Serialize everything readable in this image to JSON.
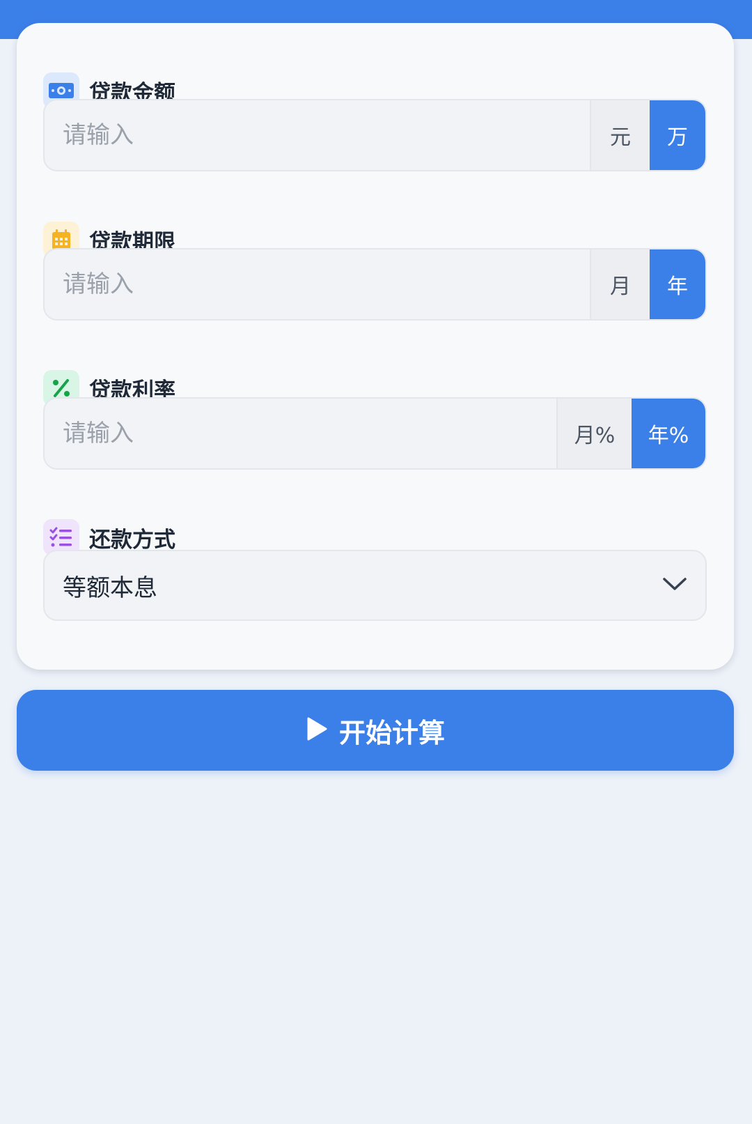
{
  "colors": {
    "accent": "#3b7fe8",
    "page_background": "#edf1f8",
    "card_background": "#f8f9fa"
  },
  "fields": {
    "amount": {
      "label": "贷款金额",
      "icon": "money-bill-icon",
      "placeholder": "请输入",
      "units": [
        "元",
        "万"
      ],
      "selected_unit": "万"
    },
    "term": {
      "label": "贷款期限",
      "icon": "calendar-icon",
      "placeholder": "请输入",
      "units": [
        "月",
        "年"
      ],
      "selected_unit": "年"
    },
    "rate": {
      "label": "贷款利率",
      "icon": "percent-icon",
      "placeholder": "请输入",
      "units": [
        "月%",
        "年%"
      ],
      "selected_unit": "年%"
    },
    "method": {
      "label": "还款方式",
      "icon": "list-check-icon",
      "selected": "等额本息"
    }
  },
  "actions": {
    "calculate_label": "开始计算",
    "calculate_icon": "play-icon"
  }
}
